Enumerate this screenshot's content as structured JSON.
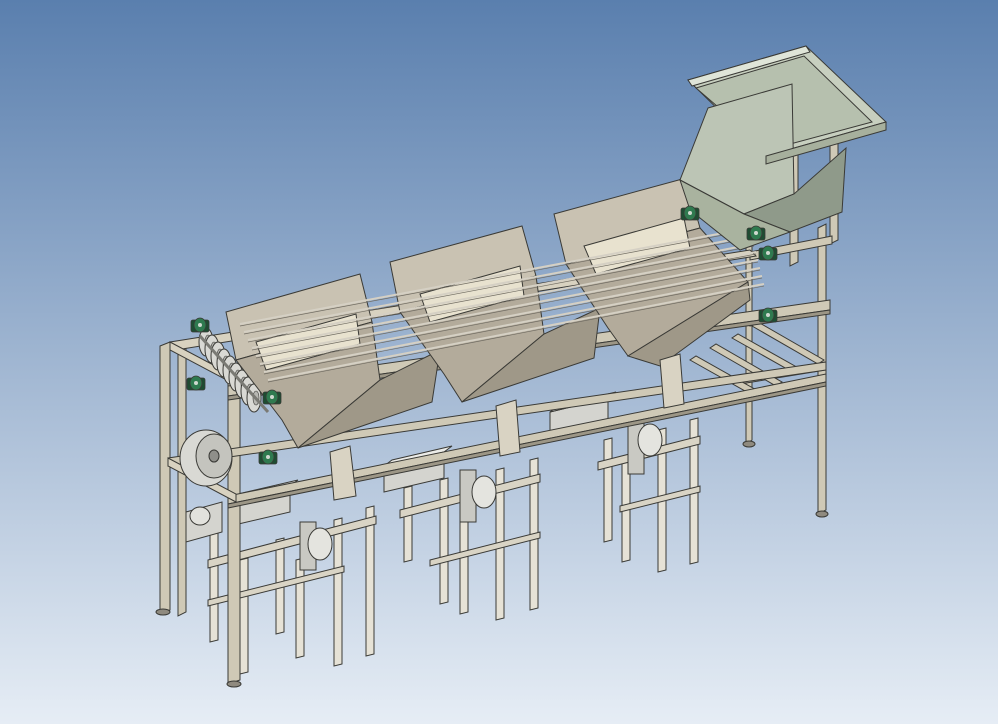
{
  "viewport": {
    "content": "cad-3d-isometric-model",
    "background_top": "#5a7fae",
    "background_bottom": "#e6edf5"
  },
  "colors": {
    "frame": "#cfc9b6",
    "frame_shade": "#9c9686",
    "frame_edge": "#3a3a36",
    "hopper_face": "#b3ab9b",
    "hopper_top": "#c9c2b2",
    "hopper_inner": "#e8e2cf",
    "feed_chute": "#bcc5b5",
    "feed_chute_dark": "#8f9a8a",
    "bearing": "#2f7a4f",
    "bearing_dark": "#1d4d32",
    "roller": "#d9d9d4",
    "motor": "#d4d4cf"
  },
  "model": {
    "hopper_count": 3,
    "bearing_count": 8,
    "roller_count": 9,
    "weigher_stand_count": 6
  }
}
